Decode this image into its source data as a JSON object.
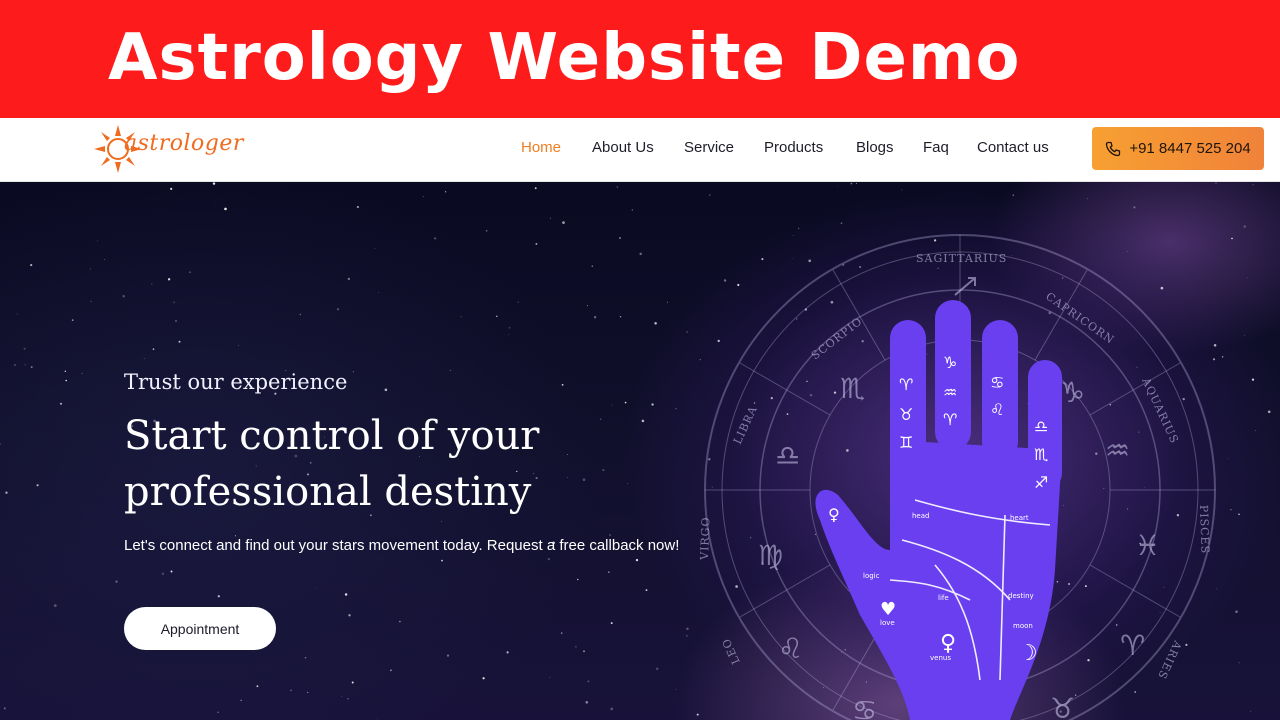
{
  "banner": {
    "title": "Astrology Website Demo"
  },
  "brand": {
    "logo_text": "astrologer",
    "accent_color": "#ef7d22"
  },
  "nav": {
    "items": [
      {
        "label": "Home",
        "active": true
      },
      {
        "label": "About Us"
      },
      {
        "label": "Service"
      },
      {
        "label": "Products"
      },
      {
        "label": "Blogs"
      },
      {
        "label": "Faq"
      },
      {
        "label": "Contact us"
      }
    ],
    "phone": {
      "label": "+91 8447 525 204",
      "icon": "phone-icon"
    }
  },
  "hero": {
    "kicker": "Trust our experience",
    "title": "Start control of your professional destiny",
    "description": "Let's connect and find out your stars movement today. Request a free callback now!",
    "cta": "Appointment"
  },
  "zodiac_wheel": {
    "signs": [
      "SAGITTARIUS",
      "CAPRICORN",
      "AQUARIUS",
      "PISCES",
      "ARIES",
      "TAURUS",
      "LEO",
      "VIRGO",
      "LIBRA",
      "SCORPIO"
    ],
    "palm_lines": [
      "head",
      "heart",
      "logic",
      "life",
      "destiny",
      "love",
      "venus",
      "moon"
    ]
  }
}
